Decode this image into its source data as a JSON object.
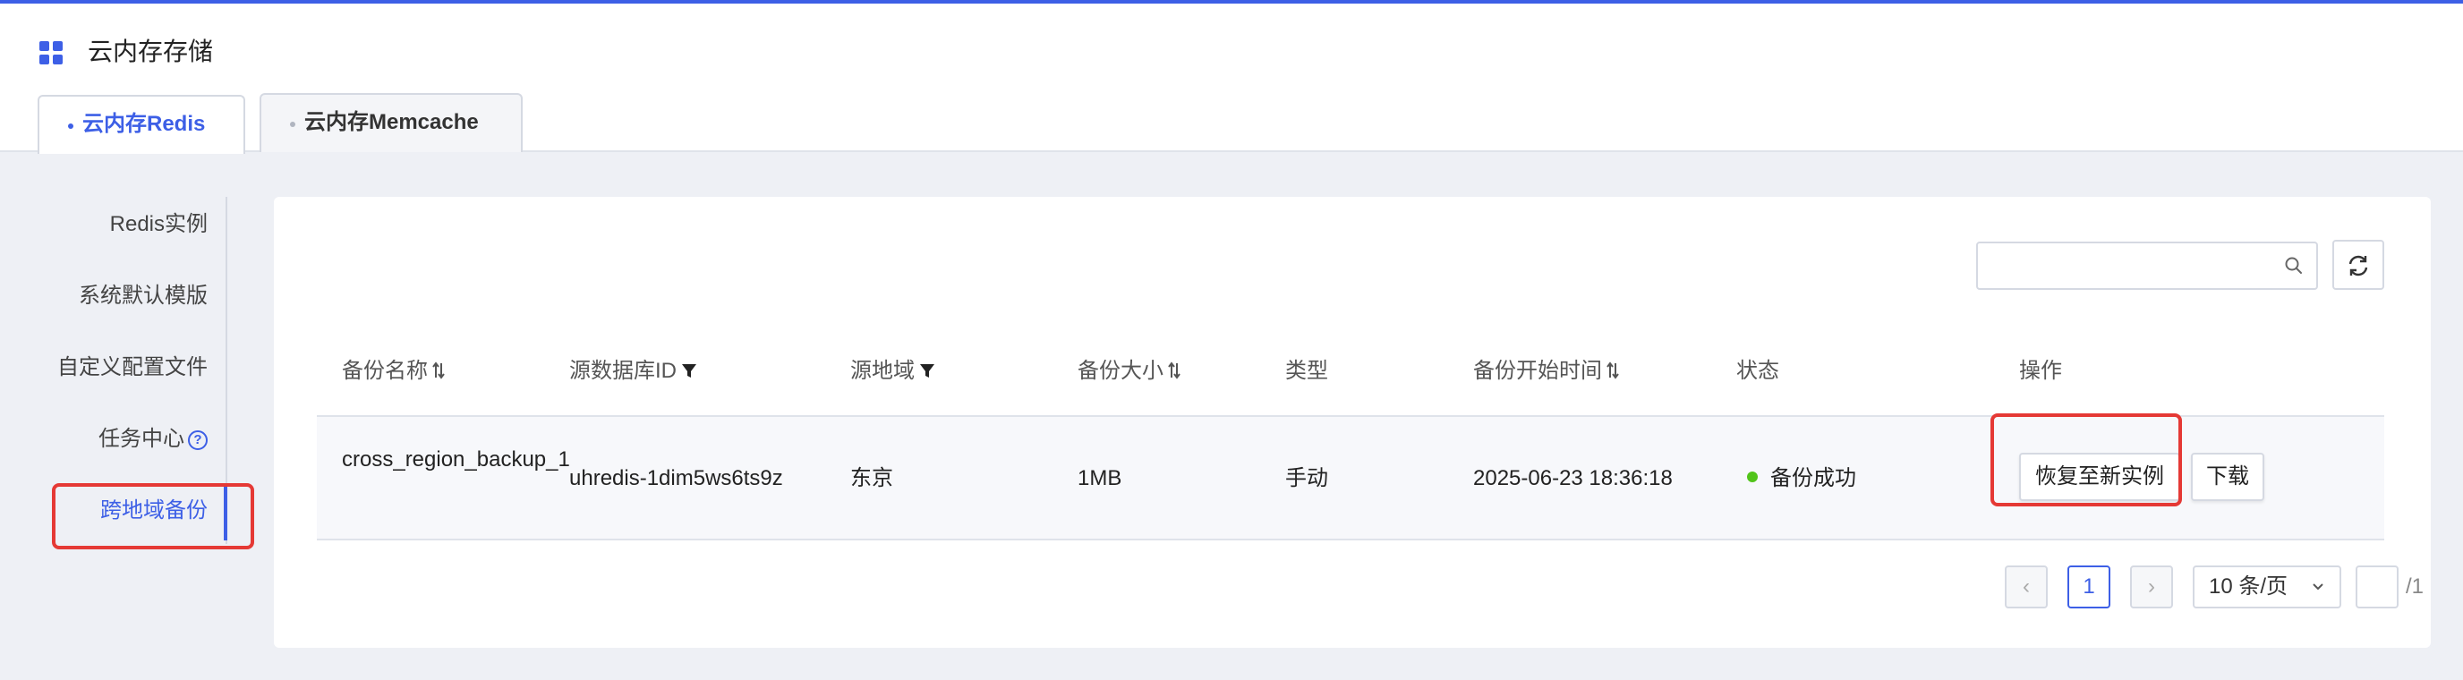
{
  "app": {
    "title": "云内存存储",
    "accent_color": "#3d5fe6"
  },
  "tabs": [
    {
      "label": "云内存Redis",
      "active": true
    },
    {
      "label": "云内存Memcache",
      "active": false
    }
  ],
  "sidebar": {
    "items": [
      {
        "label": "Redis实例",
        "active": false
      },
      {
        "label": "系统默认模版",
        "active": false
      },
      {
        "label": "自定义配置文件",
        "active": false
      },
      {
        "label": "任务中心",
        "active": false,
        "icon": "help-icon"
      },
      {
        "label": "跨地域备份",
        "active": true
      }
    ]
  },
  "toolbar": {
    "search_placeholder": "",
    "search_icon": "search-icon",
    "refresh_icon": "refresh-icon"
  },
  "table": {
    "columns": [
      {
        "label": "备份名称",
        "icon": "sort-icon"
      },
      {
        "label": "源数据库ID",
        "icon": "filter-icon"
      },
      {
        "label": "源地域",
        "icon": "filter-icon"
      },
      {
        "label": "备份大小",
        "icon": "sort-icon"
      },
      {
        "label": "类型"
      },
      {
        "label": "备份开始时间",
        "icon": "sort-icon"
      },
      {
        "label": "状态"
      },
      {
        "label": "操作"
      }
    ],
    "rows": [
      {
        "name": "cross_region_backup_1",
        "db_id": "uhredis-1dim5ws6ts9z",
        "region": "东京",
        "size": "1MB",
        "type": "手动",
        "start_time": "2025-06-23 18:36:18",
        "status": "备份成功",
        "status_color": "#52c41a",
        "actions": {
          "restore": "恢复至新实例",
          "download": "下载"
        }
      }
    ]
  },
  "pagination": {
    "prev": "‹",
    "current_page": "1",
    "next": "›",
    "page_size": "10 条/页",
    "jump_value": "",
    "total_pages": "/1"
  },
  "highlight_color": "#e53935"
}
